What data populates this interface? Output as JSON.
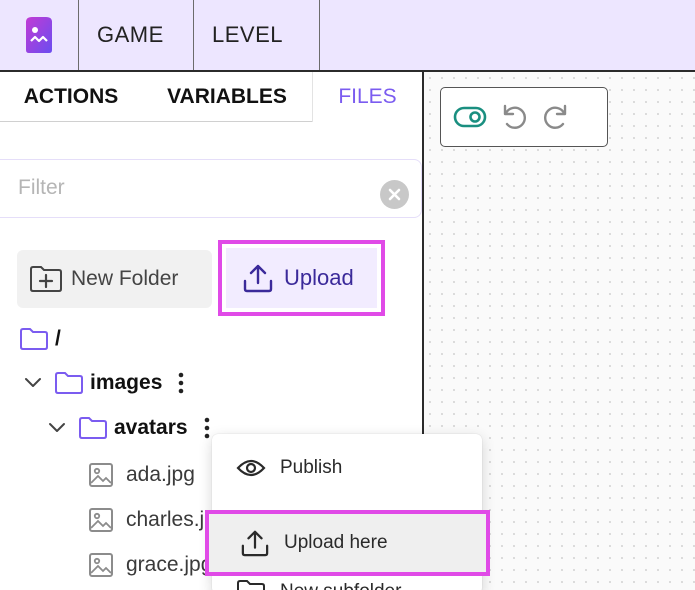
{
  "topbar": {
    "menu": [
      "GAME",
      "LEVEL"
    ]
  },
  "tabs": [
    "ACTIONS",
    "VARIABLES",
    "FILES"
  ],
  "active_tab": "FILES",
  "filter": {
    "placeholder": "Filter",
    "value": ""
  },
  "buttons": {
    "new_folder": "New Folder",
    "upload": "Upload"
  },
  "tree": {
    "root": "/",
    "folders": [
      "images",
      "avatars"
    ],
    "files": [
      "ada.jpg",
      "charles.jpg",
      "grace.jpg"
    ]
  },
  "context_menu": [
    "Publish",
    "Upload here",
    "New subfolder"
  ],
  "colors": {
    "accent": "#7b5cf0",
    "highlight": "#e04ae7",
    "topbar": "#ede6ff",
    "toggle": "#1a8f80"
  }
}
